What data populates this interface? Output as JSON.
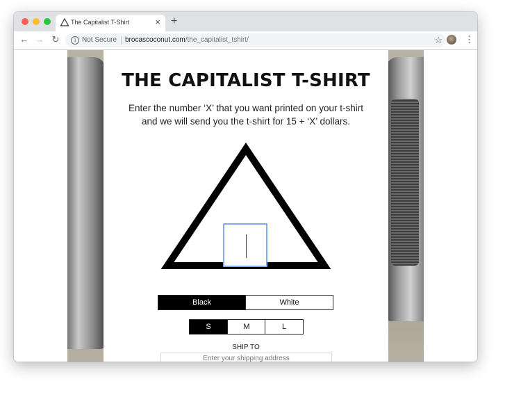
{
  "browser": {
    "tab_title": "The Capitalist T-Shirt",
    "tab_close": "×",
    "new_tab": "+",
    "security_label": "Not Secure",
    "url_domain": "brocascoconut.com",
    "url_path": "/the_capitalist_tshirt/",
    "icons": [
      "warning-triangle-icon",
      "back-arrow-icon",
      "forward-arrow-icon",
      "reload-icon",
      "info-icon",
      "star-icon",
      "kebab-menu-icon"
    ]
  },
  "page": {
    "title": "THE CAPITALIST T-SHIRT",
    "subtitle_line1": "Enter the number ‘X’ that you want printed on your t-shirt",
    "subtitle_line2": "and we will send you the t-shirt for 15 + ‘X’ dollars.",
    "number_input_value": "",
    "color_options": [
      "Black",
      "White"
    ],
    "selected_color": "Black",
    "size_options": [
      "S",
      "M",
      "L"
    ],
    "selected_size": "S",
    "ship_to_label": "SHIP TO",
    "ship_placeholder": "Enter your shipping address"
  },
  "colors": {
    "accent_focus": "#7eaaf2",
    "selected_bg": "#000000"
  }
}
